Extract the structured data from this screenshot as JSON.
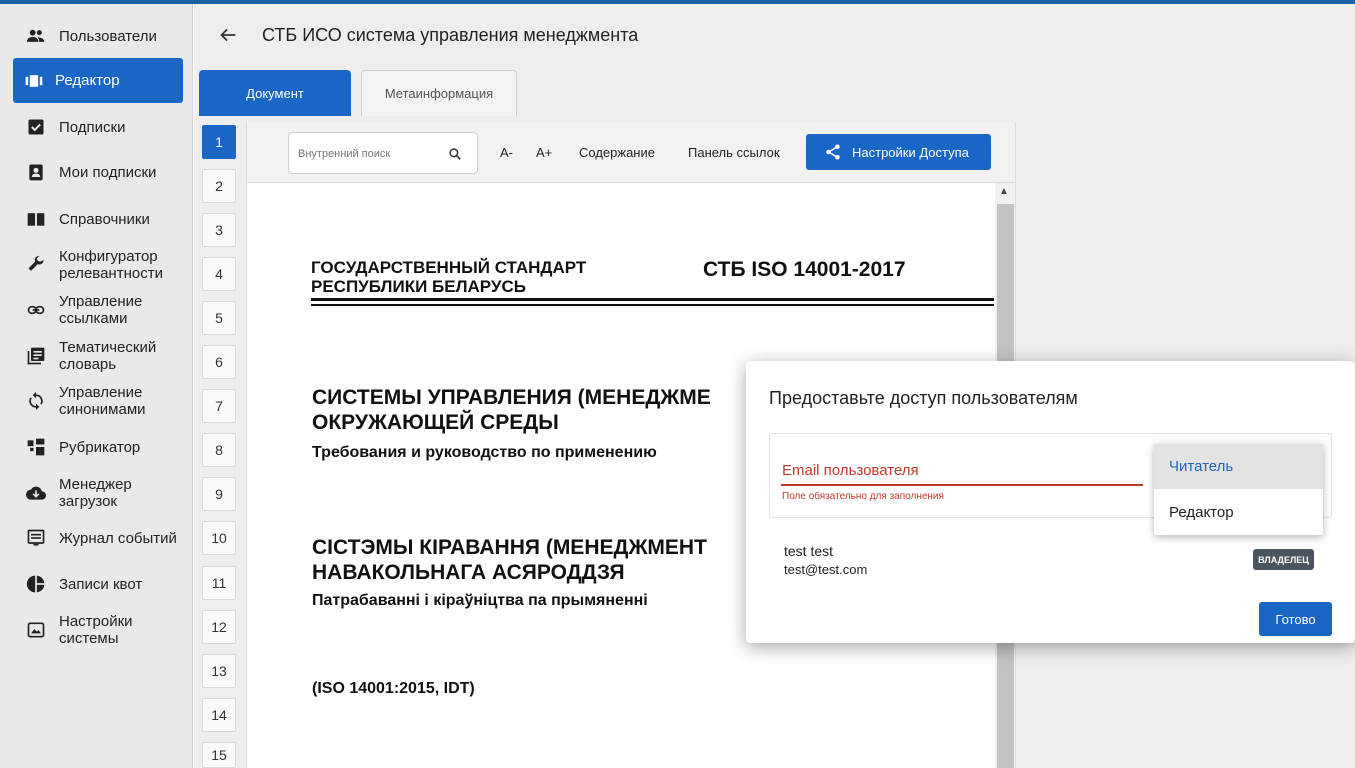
{
  "sidebar": {
    "items": [
      {
        "label": "Пользователи",
        "icon": "users-icon"
      },
      {
        "label": "Редактор",
        "icon": "editor-icon",
        "active": true
      },
      {
        "label": "Подписки",
        "icon": "checkbox-icon"
      },
      {
        "label": "Мои подписки",
        "icon": "badge-icon"
      },
      {
        "label": "Справочники",
        "icon": "book-icon"
      },
      {
        "label": "Конфигуратор релевантности",
        "icon": "wrench-icon"
      },
      {
        "label": "Управление ссылками",
        "icon": "link-icon"
      },
      {
        "label": "Тематический словарь",
        "icon": "library-icon"
      },
      {
        "label": "Управление синонимами",
        "icon": "sync-icon"
      },
      {
        "label": "Рубрикатор",
        "icon": "rubric-icon"
      },
      {
        "label": "Менеджер загрузок",
        "icon": "cloud-download-icon"
      },
      {
        "label": "Журнал событий",
        "icon": "log-icon"
      },
      {
        "label": "Записи квот",
        "icon": "pie-icon"
      },
      {
        "label": "Настройки системы",
        "icon": "settings-icon"
      }
    ]
  },
  "header": {
    "title": "СТБ ИСО система управления менеджмента"
  },
  "tabs": [
    {
      "label": "Документ"
    },
    {
      "label": "Метаинформация"
    }
  ],
  "pages": [
    "1",
    "2",
    "3",
    "4",
    "5",
    "6",
    "7",
    "8",
    "9",
    "10",
    "11",
    "12",
    "13",
    "14",
    "15"
  ],
  "toolbar": {
    "search_placeholder": "Внутренний поиск",
    "font_minus": "A-",
    "font_plus": "A+",
    "contents": "Содержание",
    "links_panel": "Панель ссылок",
    "access_settings": "Настройки Доступа"
  },
  "document": {
    "std_left_1": "ГОСУДАРСТВЕННЫЙ СТАНДАРТ",
    "std_left_2": "РЕСПУБЛИКИ БЕЛАРУСЬ",
    "std_code": "СТБ ISO 14001-2017",
    "title_ru_1": "СИСТЕМЫ УПРАВЛЕНИЯ (МЕНЕДЖМЕ",
    "title_ru_2": "ОКРУЖАЮЩЕЙ СРЕДЫ",
    "subtitle_ru": "Требования и руководство по применению",
    "title_by_1": "СІСТЭМЫ КІРАВАННЯ (МЕНЕДЖМЕНТ",
    "title_by_2": "НАВАКОЛЬНАГА АСЯРОДДЗЯ",
    "subtitle_by": "Патрабаванні і кіраўніцтва па прымяненні",
    "iso_ref": "(ISO 14001:2015, IDT)"
  },
  "dialog": {
    "title": "Предоставьте доступ пользователям",
    "email_label": "Email пользователя",
    "email_value": "",
    "email_error": "Поле обязательно для заполнения",
    "role_options": [
      "Читатель",
      "Редактор"
    ],
    "role_selected": "Читатель",
    "user_name": "test test",
    "user_email": "test@test.com",
    "owner_badge": "ВЛАДЕЛЕЦ",
    "done_label": "Готово"
  },
  "colors": {
    "accent": "#1a66c4",
    "error": "#c0392b",
    "badge": "#4a5560"
  }
}
